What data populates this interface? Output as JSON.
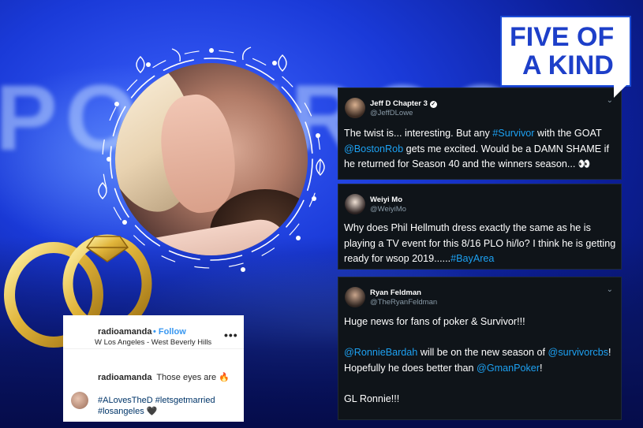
{
  "logo": {
    "line1": "FIVE OF",
    "line2": "A KIND"
  },
  "instagram": {
    "username": "radioamanda",
    "separator": "•",
    "follow_label": "Follow",
    "location": "W Los Angeles - West Beverly Hills",
    "more_label": "•••",
    "comment_user": "radioamanda",
    "comment_text": "Those eyes are 🔥",
    "caption_tags": "#ALovesTheD #letsgetmarried",
    "caption_line2": "#losangeles",
    "caption_emoji": "🖤"
  },
  "tweets": [
    {
      "name": "Jeff D Chapter 3",
      "handle": "@JeffDLowe",
      "verified": true,
      "text_parts": [
        {
          "t": "The twist is... interesting. But any ",
          "link": false
        },
        {
          "t": "#Survivor",
          "link": true
        },
        {
          "t": " with the GOAT ",
          "link": false
        },
        {
          "t": "@BostonRob",
          "link": true
        },
        {
          "t": " gets me excited. Would be a DAMN SHAME if he returned for Season 40 and the winners season... 👀",
          "link": false
        }
      ]
    },
    {
      "name": "Weiyi Mo",
      "handle": "@WeiyiMo",
      "verified": false,
      "text_parts": [
        {
          "t": "Why does Phil Hellmuth dress exactly the same as he is playing a TV event for this 8/16 PLO hi/lo? I think he is getting ready for wsop 2019......",
          "link": false
        },
        {
          "t": "#BayArea",
          "link": true
        }
      ]
    },
    {
      "name": "Ryan Feldman",
      "handle": "@TheRyanFeldman",
      "verified": false,
      "text_parts": [
        {
          "t": "Huge news for fans of poker & Survivor!!!",
          "link": false
        },
        {
          "t": "\n\n",
          "link": false
        },
        {
          "t": "@RonnieBardah",
          "link": true
        },
        {
          "t": " will be on the new season of ",
          "link": false
        },
        {
          "t": "@survivorcbs",
          "link": true
        },
        {
          "t": "! Hopefully he does better than ",
          "link": false
        },
        {
          "t": "@GmanPoker",
          "link": true
        },
        {
          "t": "!",
          "link": false
        },
        {
          "t": "\n\n",
          "link": false
        },
        {
          "t": "GL Ronnie!!!",
          "link": false
        }
      ]
    }
  ],
  "colors": {
    "tweet_bg": "#0f1419",
    "link": "#1da1f2",
    "logo_blue": "#1d3fc9",
    "ig_link": "#3897f0"
  }
}
